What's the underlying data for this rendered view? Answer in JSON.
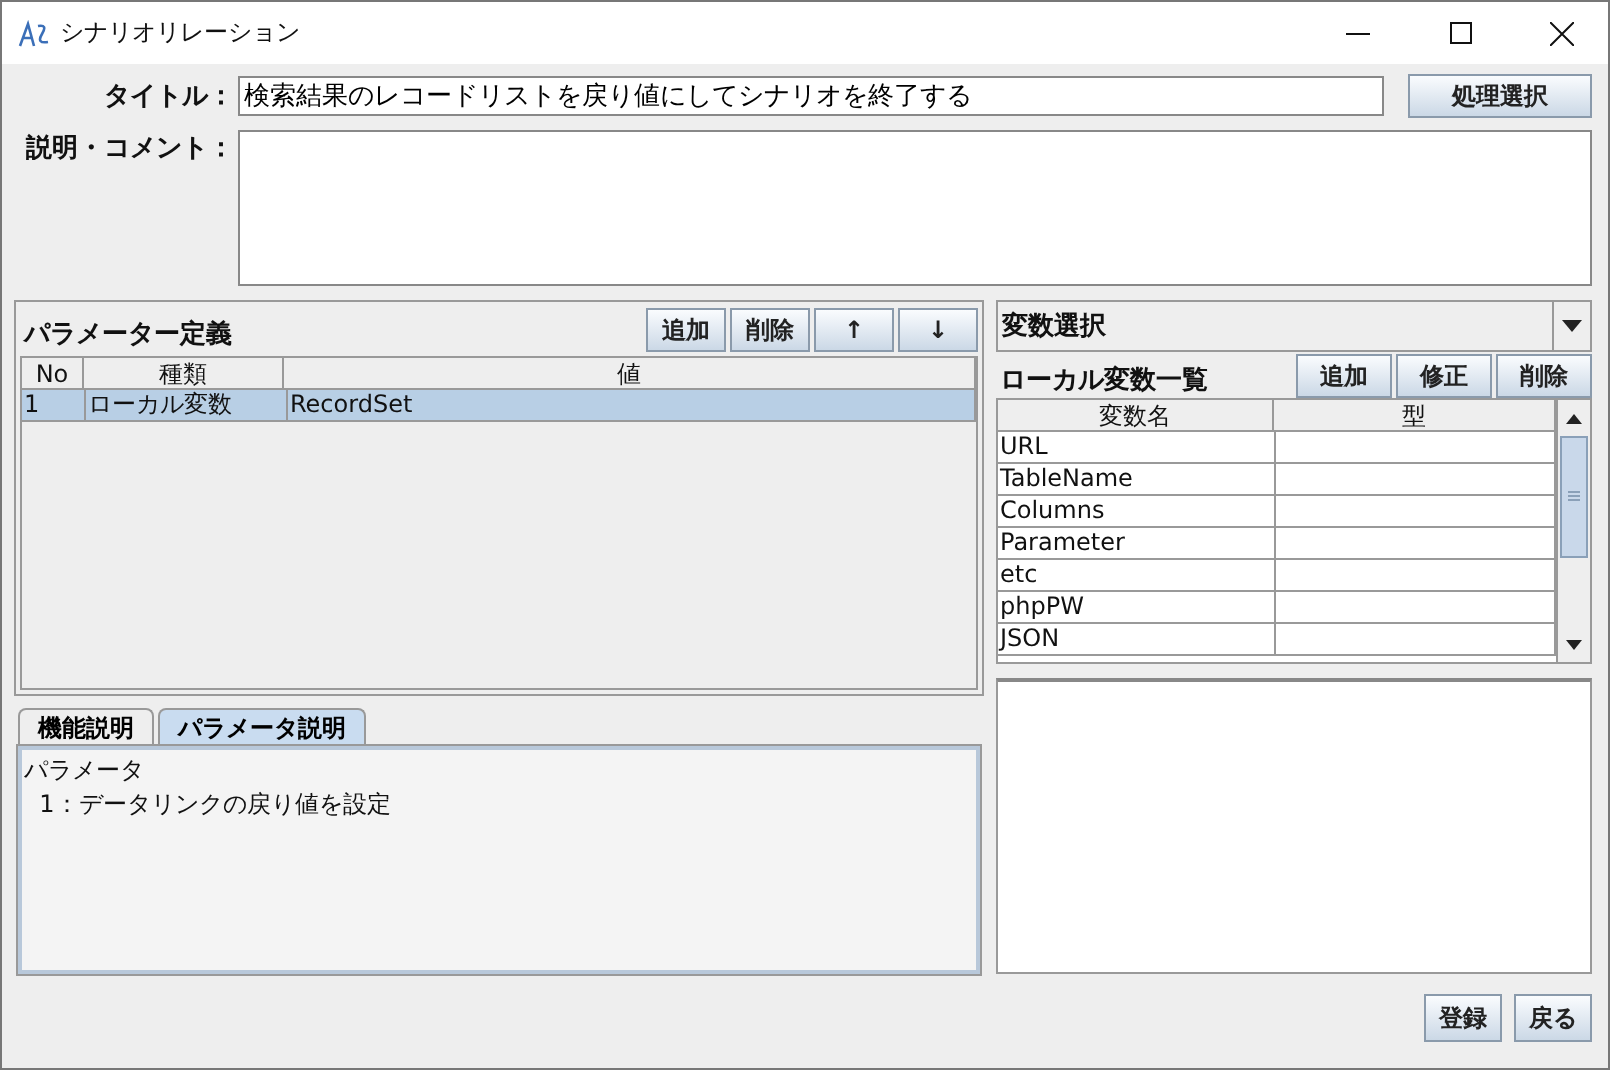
{
  "window": {
    "title": "シナリオリレーション"
  },
  "title_field": {
    "label": "タイトル：",
    "value": "検索結果のレコードリストを戻り値にしてシナリオを終了する"
  },
  "process_button": "処理選択",
  "comment_field": {
    "label": "説明・コメント："
  },
  "parameters": {
    "title": "パラメーター定義",
    "buttons": [
      "追加",
      "削除",
      "↑",
      "↓"
    ],
    "columns": [
      "No",
      "種類",
      "値"
    ],
    "rows": [
      {
        "no": "1",
        "kind": "ローカル変数",
        "value": "RecordSet",
        "selected": true
      }
    ]
  },
  "tabs": [
    {
      "label": "機能説明",
      "selected": false
    },
    {
      "label": "パラメータ説明",
      "selected": true
    }
  ],
  "description": [
    "パラメータ",
    "  1：データリンクの戻り値を設定"
  ],
  "variable_select": {
    "value": "変数選択"
  },
  "local_variables": {
    "title": "ローカル変数一覧",
    "buttons": [
      "追加",
      "修正",
      "削除"
    ],
    "columns": [
      "変数名",
      "型"
    ],
    "rows": [
      {
        "name": "URL",
        "selected": false
      },
      {
        "name": "TableName",
        "selected": false
      },
      {
        "name": "Columns",
        "selected": false
      },
      {
        "name": "Parameter",
        "selected": false
      },
      {
        "name": "etc",
        "selected": false
      },
      {
        "name": "phpPW",
        "selected": false
      },
      {
        "name": "JSON",
        "selected": false
      }
    ]
  },
  "footer_buttons": [
    "登録",
    "戻る"
  ]
}
